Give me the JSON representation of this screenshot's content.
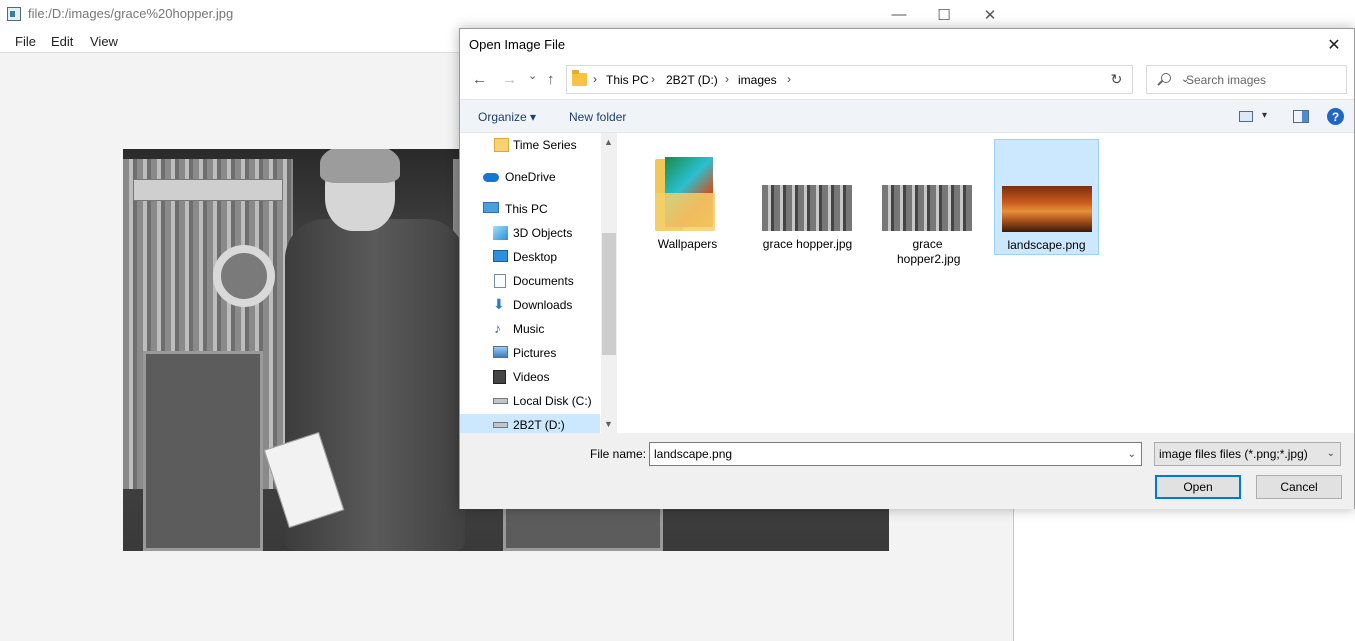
{
  "viewer": {
    "title": "file:/D:/images/grace%20hopper.jpg",
    "menu": [
      "File",
      "Edit",
      "View"
    ],
    "window_buttons": [
      "—",
      "☐",
      "✕"
    ]
  },
  "dialog": {
    "title": "Open Image File",
    "close_glyph": "✕",
    "nav": {
      "back": "←",
      "forward": "→",
      "recent": "⌄",
      "up": "↑",
      "dropdown": "⌄",
      "refresh": "↻"
    },
    "breadcrumb": [
      "This PC",
      "2B2T (D:)",
      "images"
    ],
    "search_placeholder": "Search images",
    "toolbar": {
      "organize": "Organize ▾",
      "new_folder": "New folder",
      "view_dropdown": "▾",
      "help": "?"
    },
    "nav_items": [
      {
        "label": "Time Series",
        "icon": "folder-icon"
      },
      {
        "label": "OneDrive",
        "icon": "cloud-icon"
      },
      {
        "label": "This PC",
        "icon": "computer-icon"
      },
      {
        "label": "3D Objects",
        "icon": "cube-icon"
      },
      {
        "label": "Desktop",
        "icon": "desktop-icon"
      },
      {
        "label": "Documents",
        "icon": "document-icon"
      },
      {
        "label": "Downloads",
        "icon": "download-icon"
      },
      {
        "label": "Music",
        "icon": "music-icon"
      },
      {
        "label": "Pictures",
        "icon": "pictures-icon"
      },
      {
        "label": "Videos",
        "icon": "video-icon"
      },
      {
        "label": "Local Disk (C:)",
        "icon": "drive-icon"
      },
      {
        "label": "2B2T (D:)",
        "icon": "drive-icon",
        "selected": true
      }
    ],
    "scroll": {
      "up": "▲",
      "down": "▼"
    },
    "files": [
      {
        "label": "Wallpapers",
        "type": "folder"
      },
      {
        "label": "grace hopper.jpg",
        "type": "image"
      },
      {
        "label": "grace hopper2.jpg",
        "type": "image"
      },
      {
        "label": "landscape.png",
        "type": "image",
        "selected": true
      }
    ],
    "filename_label": "File name:",
    "filename_value": "landscape.png",
    "filename_dropdown": "⌄",
    "filter_value": "image files files (*.png;*.jpg)",
    "filter_dropdown": "⌄",
    "open_label": "Open",
    "cancel_label": "Cancel"
  }
}
